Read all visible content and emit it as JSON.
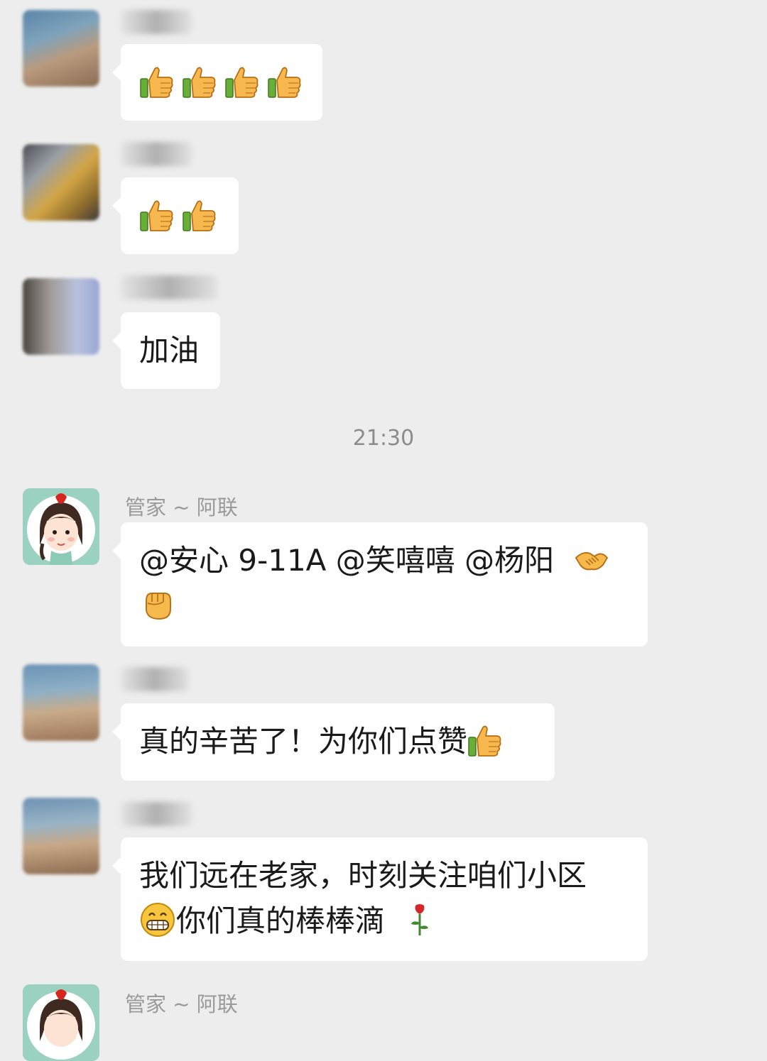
{
  "chat": {
    "timestamp": "21:30",
    "messages": [
      {
        "sender": "",
        "text": "",
        "emoji": [
          "thumbs-up",
          "thumbs-up",
          "thumbs-up",
          "thumbs-up"
        ]
      },
      {
        "sender": "",
        "text": "",
        "emoji": [
          "thumbs-up",
          "thumbs-up"
        ]
      },
      {
        "sender": "",
        "text": "加油"
      },
      {
        "sender": "管家 ~ 阿联",
        "line1": "@安心 9-11A @笑嘻嘻 @杨阳",
        "emoji": [
          "handshake",
          "raised-fist"
        ]
      },
      {
        "sender": "",
        "text": "真的辛苦了！为你们点赞",
        "emoji": [
          "thumbs-up"
        ]
      },
      {
        "sender": "",
        "line1": "我们远在老家，时刻关注咱们小区",
        "line2": "你们真的棒棒滴",
        "emoji": [
          "grin",
          "rose"
        ]
      },
      {
        "sender": "管家 ~ 阿联"
      }
    ]
  },
  "colors": {
    "background": "#ededed",
    "bubble": "#ffffff",
    "text": "#1a1a1a",
    "name": "#9a9a9a",
    "timestamp": "#8c8c8c"
  }
}
